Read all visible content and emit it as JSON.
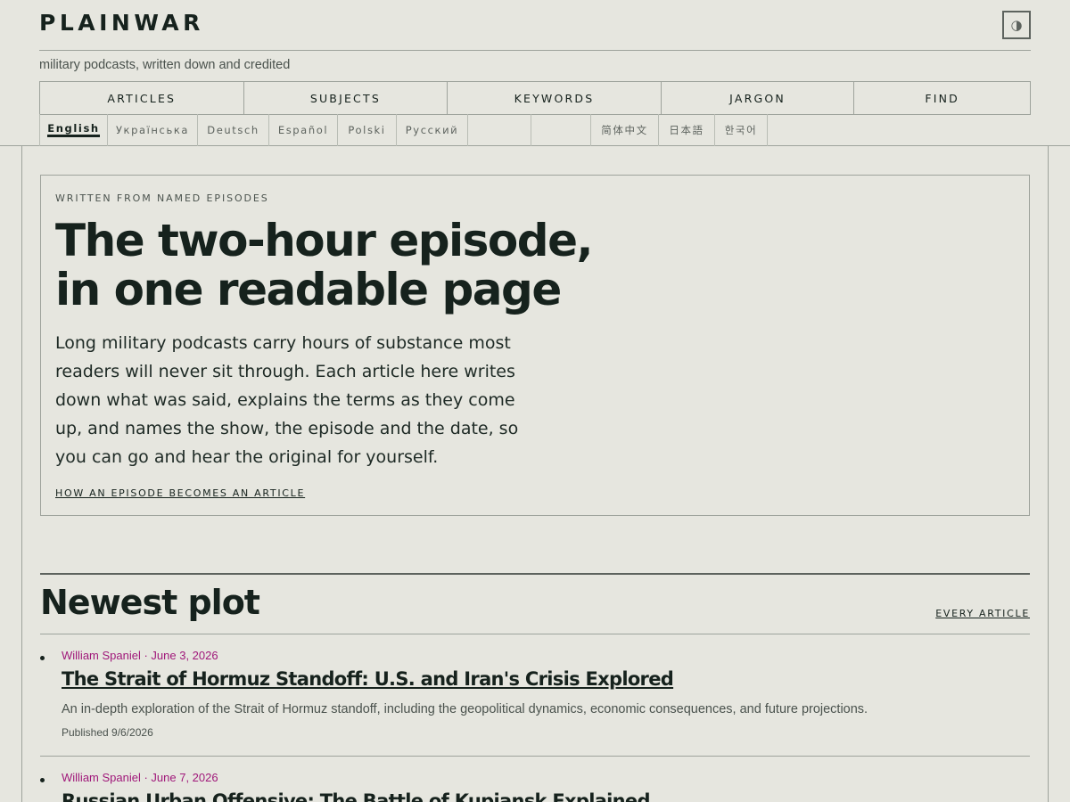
{
  "header": {
    "brand": "PLAINWAR",
    "tagline": "military podcasts, written down and credited",
    "theme_toggle_icon": "half-circle-icon",
    "nav": [
      {
        "label": "ARTICLES"
      },
      {
        "label": "SUBJECTS"
      },
      {
        "label": "KEYWORDS"
      },
      {
        "label": "JARGON"
      },
      {
        "label": "FIND"
      }
    ],
    "languages": [
      {
        "label": "English"
      },
      {
        "label": "Українська"
      },
      {
        "label": "Deutsch"
      },
      {
        "label": "Español"
      },
      {
        "label": "Polski"
      },
      {
        "label": "Русский"
      },
      {
        "label": ""
      },
      {
        "label": ""
      },
      {
        "label": "简体中文"
      },
      {
        "label": "日本語"
      },
      {
        "label": "한국어"
      }
    ],
    "active_language": "English"
  },
  "hero": {
    "eyebrow": "WRITTEN FROM NAMED EPISODES",
    "title_line1": "The two-hour episode,",
    "title_line2": "in one readable page",
    "body": "Long military podcasts carry hours of substance most readers will never sit through. Each article here writes down what was said, explains the terms as they come up, and names the show, the episode and the date, so you can go and hear the original for yourself.",
    "link": "HOW AN EPISODE BECOMES AN ARTICLE"
  },
  "newest": {
    "title": "Newest plot",
    "every_link": "EVERY ARTICLE",
    "articles": [
      {
        "byline": "William Spaniel · June 3, 2026",
        "title": "The Strait of Hormuz Standoff: U.S. and Iran's Crisis Explored",
        "description": "An in-depth exploration of the Strait of Hormuz standoff, including the geopolitical dynamics, economic consequences, and future projections.",
        "published": "Published 9/6/2026"
      },
      {
        "byline": "William Spaniel · June 7, 2026",
        "title": "Russian Urban Offensive: The Battle of Kupiansk Explained"
      }
    ]
  }
}
